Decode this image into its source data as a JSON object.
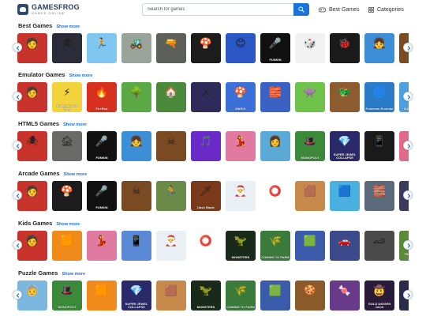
{
  "header": {
    "logo": {
      "name": "GAMESFROG",
      "tagline": "GAMES ONLINE"
    },
    "search": {
      "placeholder": "Search for games",
      "icon": "search-icon"
    },
    "nav": {
      "best": "Best Games",
      "categories": "Categories"
    }
  },
  "colors": {
    "accent": "#1a73d9",
    "brand": "#2a3f5f",
    "text": "#222222"
  },
  "sections": [
    {
      "id": "best",
      "title": "Best Games",
      "more": "Show more",
      "tiles": [
        {
          "bg": "#c8342c",
          "glyph": "🧑",
          "label": ""
        },
        {
          "bg": "#2b2b3a",
          "glyph": "🕷",
          "label": ""
        },
        {
          "bg": "#7fc7f0",
          "glyph": "🏃",
          "label": ""
        },
        {
          "bg": "#9aa39a",
          "glyph": "🚜",
          "label": ""
        },
        {
          "bg": "#5c5f5a",
          "glyph": "🔫",
          "label": ""
        },
        {
          "bg": "#1c1c1c",
          "glyph": "🍄",
          "label": ""
        },
        {
          "bg": "#2a56c6",
          "glyph": "😊",
          "label": ""
        },
        {
          "bg": "#111111",
          "glyph": "🎤",
          "label": "FUNKIN"
        },
        {
          "bg": "#f2f2f2",
          "glyph": "🎲",
          "label": ""
        },
        {
          "bg": "#1a1a1a",
          "glyph": "🐞",
          "label": ""
        },
        {
          "bg": "#3c8fd6",
          "glyph": "👧",
          "label": ""
        },
        {
          "bg": "#7a4a22",
          "glyph": "☠",
          "label": ""
        },
        {
          "bg": "#4a6fae",
          "glyph": "",
          "label": ""
        }
      ]
    },
    {
      "id": "emulator",
      "title": "Emulator Games",
      "more": "Show more",
      "tiles": [
        {
          "bg": "#c8342c",
          "glyph": "🧑",
          "label": ""
        },
        {
          "bg": "#f2d33b",
          "glyph": "⚡",
          "label": "Pokemon Ash Gray"
        },
        {
          "bg": "#d8301f",
          "glyph": "🔥",
          "label": "FireRed"
        },
        {
          "bg": "#5aa945",
          "glyph": "🌳",
          "label": ""
        },
        {
          "bg": "#4c8a3b",
          "glyph": "🏠",
          "label": ""
        },
        {
          "bg": "#2e2a5a",
          "glyph": "⚔",
          "label": ""
        },
        {
          "bg": "#3c6fd8",
          "glyph": "🍄",
          "label": "MARIO"
        },
        {
          "bg": "#3a62c4",
          "glyph": "🧱",
          "label": ""
        },
        {
          "bg": "#6fc24a",
          "glyph": "👾",
          "label": ""
        },
        {
          "bg": "#8c5b2f",
          "glyph": "🐲",
          "label": ""
        },
        {
          "bg": "#2a7cc8",
          "glyph": "🌀",
          "label": "Pokemon Emerald"
        },
        {
          "bg": "#4aa0e0",
          "glyph": "🍄",
          "label": "MARIO BROS"
        },
        {
          "bg": "#333333",
          "glyph": "",
          "label": ""
        }
      ]
    },
    {
      "id": "html5",
      "title": "HTML5 Games",
      "more": "Show more",
      "tiles": [
        {
          "bg": "#c8342c",
          "glyph": "🕷",
          "label": ""
        },
        {
          "bg": "#6a6a66",
          "glyph": "🏚",
          "label": ""
        },
        {
          "bg": "#111111",
          "glyph": "🎤",
          "label": "FUNKIN"
        },
        {
          "bg": "#3c8fd6",
          "glyph": "👧",
          "label": ""
        },
        {
          "bg": "#7a4a22",
          "glyph": "☠",
          "label": ""
        },
        {
          "bg": "#6a2ac8",
          "glyph": "🎵",
          "label": ""
        },
        {
          "bg": "#e07aa0",
          "glyph": "💃",
          "label": ""
        },
        {
          "bg": "#5aa9d6",
          "glyph": "👩",
          "label": ""
        },
        {
          "bg": "#3a8a3a",
          "glyph": "🎩",
          "label": "MONOPOLY"
        },
        {
          "bg": "#2a2a6a",
          "glyph": "💎",
          "label": "SUPER JEWEL COLLAPSE"
        },
        {
          "bg": "#1a1a1a",
          "glyph": "📱",
          "label": ""
        },
        {
          "bg": "#e06a8a",
          "glyph": "👭",
          "label": ""
        },
        {
          "bg": "#f0c0d0",
          "glyph": "",
          "label": ""
        }
      ]
    },
    {
      "id": "arcade",
      "title": "Arcade Games",
      "more": "Show more",
      "tiles": [
        {
          "bg": "#c8342c",
          "glyph": "🧑",
          "label": ""
        },
        {
          "bg": "#1c1c1c",
          "glyph": "🍄",
          "label": ""
        },
        {
          "bg": "#111111",
          "glyph": "🎤",
          "label": "FUNKIN"
        },
        {
          "bg": "#7a4a22",
          "glyph": "☠",
          "label": ""
        },
        {
          "bg": "#6a8a4a",
          "glyph": "🏃",
          "label": ""
        },
        {
          "bg": "#7a3a1a",
          "glyph": "🗡",
          "label": "Dash Blade"
        },
        {
          "bg": "#e8f0f6",
          "glyph": "🎅",
          "label": ""
        },
        {
          "bg": "#ffffff",
          "glyph": "⭕",
          "label": ""
        },
        {
          "bg": "#c88a4a",
          "glyph": "🟫",
          "label": ""
        },
        {
          "bg": "#4ab0e0",
          "glyph": "🟦",
          "label": ""
        },
        {
          "bg": "#5a6a7a",
          "glyph": "🧱",
          "label": ""
        },
        {
          "bg": "#3a3a5a",
          "glyph": "🕹",
          "label": ""
        },
        {
          "bg": "#4a7ac8",
          "glyph": "",
          "label": ""
        }
      ]
    },
    {
      "id": "kids",
      "title": "Kids Games",
      "more": "Show more",
      "tiles": [
        {
          "bg": "#c8342c",
          "glyph": "🧑",
          "label": ""
        },
        {
          "bg": "#f08a1a",
          "glyph": "🟧",
          "label": ""
        },
        {
          "bg": "#e07aa0",
          "glyph": "💃",
          "label": ""
        },
        {
          "bg": "#5a8ad6",
          "glyph": "📱",
          "label": ""
        },
        {
          "bg": "#e8f0f6",
          "glyph": "🎅",
          "label": ""
        },
        {
          "bg": "#ffffff",
          "glyph": "⭕",
          "label": ""
        },
        {
          "bg": "#1a2a1a",
          "glyph": "🦖",
          "label": "MONSTERS"
        },
        {
          "bg": "#3a7a3a",
          "glyph": "🌾",
          "label": "COMING TO FARM"
        },
        {
          "bg": "#3a5aaa",
          "glyph": "🟩",
          "label": ""
        },
        {
          "bg": "#3a4a8a",
          "glyph": "🚗",
          "label": ""
        },
        {
          "bg": "#4a4a4a",
          "glyph": "🏎",
          "label": ""
        },
        {
          "bg": "#5a8a3a",
          "glyph": "🐛",
          "label": "FIND INSECT NAMES"
        },
        {
          "bg": "#e8c8d8",
          "glyph": "",
          "label": ""
        }
      ]
    },
    {
      "id": "puzzle",
      "title": "Puzzle Games",
      "more": "Show more",
      "tiles": [
        {
          "bg": "#7ab8e0",
          "glyph": "🧓",
          "label": ""
        },
        {
          "bg": "#3a8a3a",
          "glyph": "🎩",
          "label": "MONOPOLY"
        },
        {
          "bg": "#f08a1a",
          "glyph": "🟧",
          "label": ""
        },
        {
          "bg": "#2a2a6a",
          "glyph": "💎",
          "label": "SUPER JEWEL COLLAPSE"
        },
        {
          "bg": "#c88a4a",
          "glyph": "🟫",
          "label": ""
        },
        {
          "bg": "#1a2a1a",
          "glyph": "🦖",
          "label": "MONSTERS"
        },
        {
          "bg": "#3a7a3a",
          "glyph": "🌾",
          "label": "COMING TO FARM"
        },
        {
          "bg": "#3a5aaa",
          "glyph": "🟩",
          "label": ""
        },
        {
          "bg": "#8a5a2a",
          "glyph": "🍪",
          "label": ""
        },
        {
          "bg": "#6a3a8a",
          "glyph": "🍬",
          "label": ""
        },
        {
          "bg": "#2a1a3a",
          "glyph": "🤠",
          "label": "GOLD DIGGER JACK"
        },
        {
          "bg": "#2a2a4a",
          "glyph": "🧩",
          "label": ""
        },
        {
          "bg": "#4a4a4a",
          "glyph": "",
          "label": ""
        }
      ]
    }
  ],
  "arrows": {
    "left": "chevron-left-icon",
    "right": "chevron-right-icon"
  }
}
